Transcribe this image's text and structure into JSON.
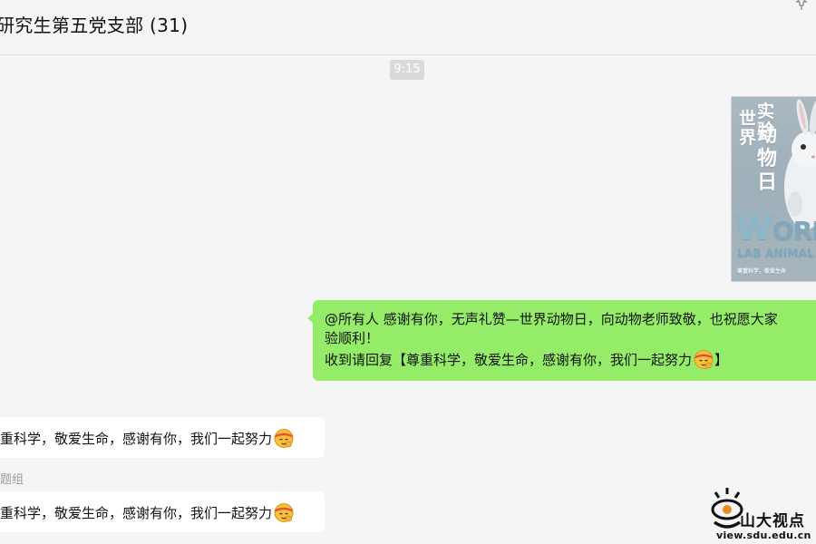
{
  "header": {
    "title": "研究生第五党支部 (31)"
  },
  "chat": {
    "time": "9:15",
    "image": {
      "title_world": "世界",
      "title_shiyan": "实验",
      "title_dongwu": "动物日",
      "world_big": "W",
      "world_rest": "ORLD",
      "lab_animal": "LAB ANIMAL",
      "caption": "尊重科学，敬爱生命"
    },
    "green_message": {
      "line1": "@所有人 感谢有你，无声礼赞—世界动物日，向动物老师致敬，也祝愿大家",
      "line2": "验顺利！",
      "line3": "收到请回复【尊重科学，敬爱生命，感谢有你，我们一起努力",
      "line3_end": "】"
    },
    "reply1": {
      "text": "重科学，敬爱生命，感谢有你，我们一起努力"
    },
    "sender2": "题组",
    "reply2": {
      "text": "重科学，敬爱生命，感谢有你，我们一起努力"
    }
  },
  "watermark": {
    "name": "山大视点",
    "url": "view.sdu.edu.cn"
  },
  "icons": {
    "pin": "pin-icon",
    "emoji": "headband-face-emoji-icon",
    "logo": "sdu-view-logo-icon"
  },
  "colors": {
    "background": "#f5f5f5",
    "self_bubble": "#95ec69",
    "other_bubble": "#ffffff"
  }
}
